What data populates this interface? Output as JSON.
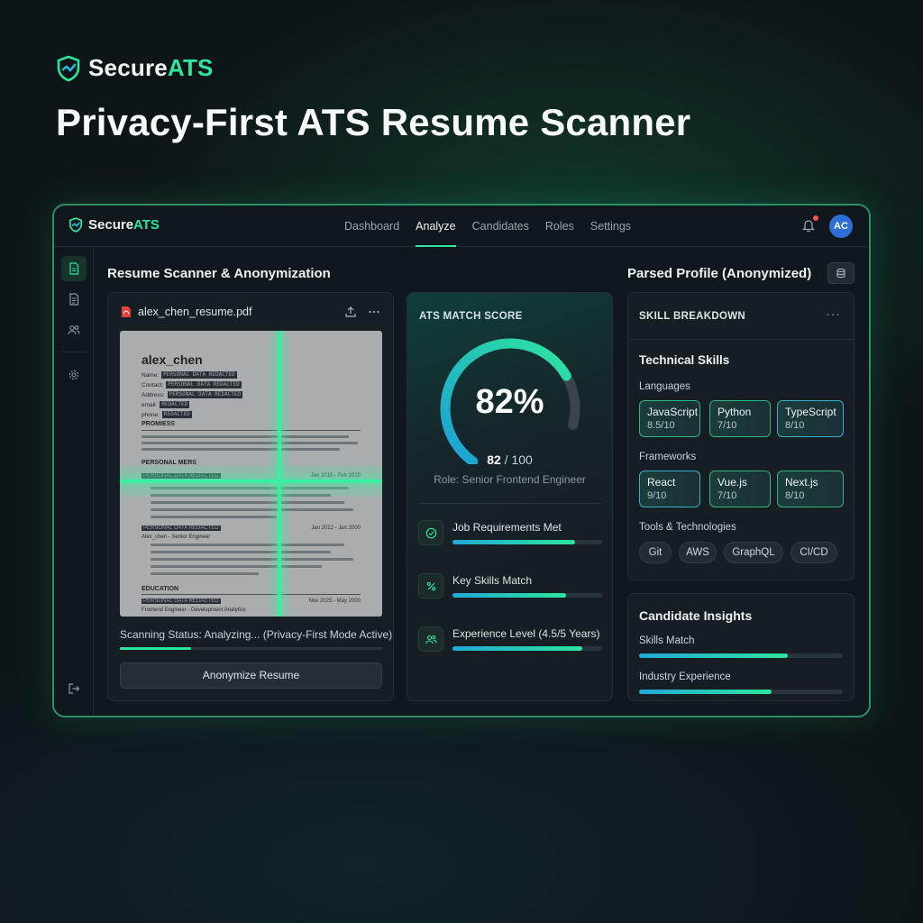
{
  "header": {
    "brand_prefix": "Secure",
    "brand_accent": "ATS",
    "title": "Privacy-First ATS Resume Scanner"
  },
  "app": {
    "brand_prefix": "Secure",
    "brand_accent": "ATS",
    "nav": [
      "Dashboard",
      "Analyze",
      "Candidates",
      "Roles",
      "Settings"
    ],
    "active_nav": "Analyze",
    "avatar_initials": "AC",
    "has_notification": true
  },
  "sidebar": {
    "items": [
      {
        "icon": "scan-document-icon",
        "active": true
      },
      {
        "icon": "document-icon",
        "active": false
      },
      {
        "icon": "users-icon",
        "active": false
      },
      {
        "icon": "gear-icon",
        "active": false
      },
      {
        "icon": "logout-icon",
        "active": false
      }
    ]
  },
  "scanner": {
    "section_title": "Resume Scanner & Anonymization",
    "file_name": "alex_chen_resume.pdf",
    "resume": {
      "name": "alex_chen",
      "fields": [
        {
          "label": "Name:",
          "value": "PERSONAL DATA REDACTED"
        },
        {
          "label": "Contact:",
          "value": "PERSONAL DATA REDACTED"
        },
        {
          "label": "Address:",
          "value": "PERSONAL DATA REDACTED"
        },
        {
          "label": "email:",
          "value": "REDACTED"
        },
        {
          "label": "phone:",
          "value": "REDACTED"
        }
      ],
      "sections": [
        {
          "heading": "PROMIESS",
          "dates": ""
        },
        {
          "heading": "PERSONAL MERS",
          "dates": ""
        },
        {
          "heading": "PERSONAL DATA REDACTED",
          "dates": "Jan 2015 - Feb 2020"
        },
        {
          "heading": "PERSONAL DATA REDACTED",
          "dates": "Jan 2012 - Jan 2000"
        },
        {
          "heading": "Alex_chen - Senior Engineer",
          "dates": ""
        },
        {
          "heading": "EDUCATION",
          "dates": ""
        },
        {
          "heading": "PERSONAL DATA REDACTED",
          "dates": "Nov 2025 - May 2000"
        },
        {
          "heading": "Frontend Engineer - Development Analytics",
          "dates": ""
        }
      ]
    },
    "status_text": "Scanning Status: Analyzing... (Privacy-First Mode Active)",
    "scan_progress": 0.27,
    "anonymize_label": "Anonymize Resume"
  },
  "score": {
    "label": "ATS MATCH SCORE",
    "percent_text": "82%",
    "value": 82,
    "max": 100,
    "value_text": "82",
    "max_text": "/ 100",
    "role": "Role: Senior Frontend Engineer",
    "metrics": [
      {
        "label": "Job Requirements Met",
        "icon": "check-circle-icon",
        "progress": 0.82
      },
      {
        "label": "Key Skills Match",
        "icon": "percent-icon",
        "progress": 0.76
      },
      {
        "label": "Experience Level (4.5/5 Years)",
        "icon": "users-icon",
        "progress": 0.87
      }
    ]
  },
  "profile": {
    "section_title": "Parsed Profile (Anonymized)",
    "breakdown_label": "SKILL BREAKDOWN",
    "more": "···",
    "technical_title": "Technical Skills",
    "languages_label": "Languages",
    "languages": [
      {
        "name": "JavaScript",
        "score": "8.5/10"
      },
      {
        "name": "Python",
        "score": "7/10"
      },
      {
        "name": "TypeScript",
        "score": "8/10"
      }
    ],
    "frameworks_label": "Frameworks",
    "frameworks": [
      {
        "name": "React",
        "score": "9/10"
      },
      {
        "name": "Vue.js",
        "score": "7/10"
      },
      {
        "name": "Next.js",
        "score": "8/10"
      }
    ],
    "tools_label": "Tools & Technologies",
    "tools": [
      "Git",
      "AWS",
      "GraphQL",
      "CI/CD"
    ]
  },
  "insights": {
    "title": "Candidate Insights",
    "items": [
      {
        "label": "Skills Match",
        "progress": 0.73
      },
      {
        "label": "Industry Experience",
        "progress": 0.65
      }
    ]
  },
  "colors": {
    "accent": "#2ee59d",
    "background": "#0e1519",
    "card": "#161e24",
    "blue": "#1fa9d8",
    "notification": "#ff4d5e"
  }
}
